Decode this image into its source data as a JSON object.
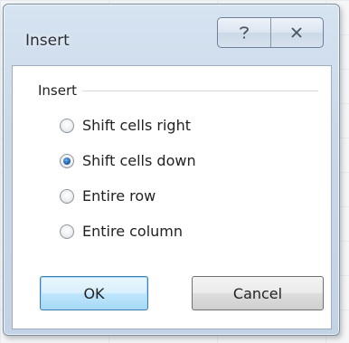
{
  "dialog": {
    "title": "Insert",
    "help_icon": "question-icon",
    "close_icon": "close-icon"
  },
  "group": {
    "label": "Insert",
    "options": [
      {
        "label": "Shift cells right",
        "checked": false
      },
      {
        "label": "Shift cells down",
        "checked": true
      },
      {
        "label": "Entire row",
        "checked": false
      },
      {
        "label": "Entire column",
        "checked": false
      }
    ]
  },
  "buttons": {
    "ok_label": "OK",
    "cancel_label": "Cancel"
  },
  "colors": {
    "accent": "#1f5fa6",
    "window_frame": "#c9d8e9"
  }
}
